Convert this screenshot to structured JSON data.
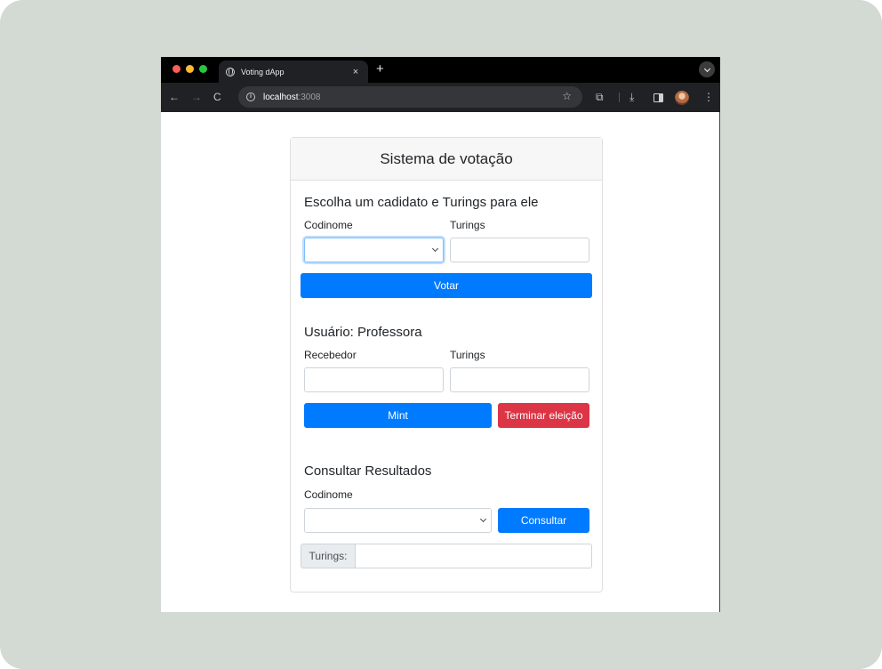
{
  "browser": {
    "tab_title": "Voting dApp",
    "tab_close": "×",
    "new_tab": "+",
    "url_host": "localhost",
    "url_port": ":3008",
    "icons": {
      "back": "←",
      "forward": "→",
      "reload": "C",
      "info": "i",
      "star": "☆",
      "extensions": "⧉",
      "download": "⤓",
      "menu": "⋮"
    }
  },
  "app": {
    "title": "Sistema de votação",
    "vote_section": {
      "heading": "Escolha um cadidato e Turings para ele",
      "codename_label": "Codinome",
      "turings_label": "Turings",
      "codename_value": "",
      "turings_value": "",
      "vote_button": "Votar"
    },
    "user_section": {
      "heading": "Usuário: Professora",
      "recipient_label": "Recebedor",
      "turings_label": "Turings",
      "recipient_value": "",
      "turings_value": "",
      "mint_button": "Mint",
      "end_button": "Terminar eleição"
    },
    "results_section": {
      "heading": "Consultar Resultados",
      "codename_label": "Codinome",
      "codename_value": "",
      "query_button": "Consultar",
      "turings_prefix": "Turings:",
      "turings_value": ""
    }
  },
  "colors": {
    "primary": "#007bff",
    "danger": "#dc3545",
    "backdrop": "#d3d9d3"
  }
}
